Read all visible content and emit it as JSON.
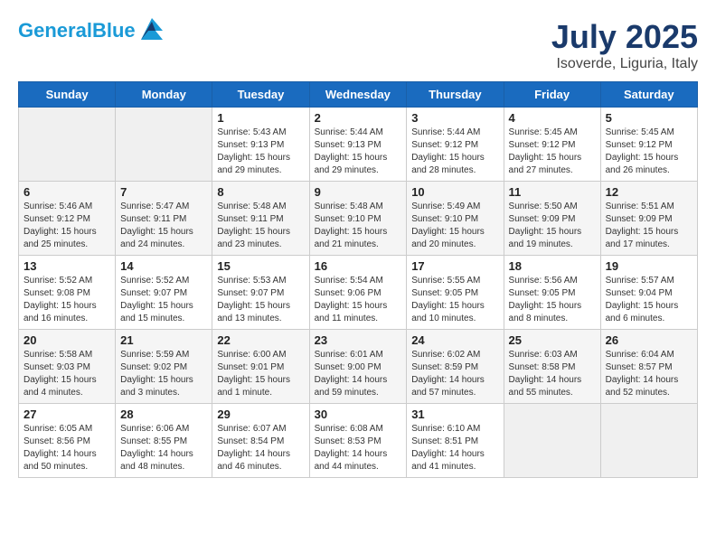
{
  "header": {
    "logo_line1": "General",
    "logo_line2": "Blue",
    "month": "July 2025",
    "location": "Isoverde, Liguria, Italy"
  },
  "days_of_week": [
    "Sunday",
    "Monday",
    "Tuesday",
    "Wednesday",
    "Thursday",
    "Friday",
    "Saturday"
  ],
  "weeks": [
    [
      {
        "day": "",
        "sunrise": "",
        "sunset": "",
        "daylight": ""
      },
      {
        "day": "",
        "sunrise": "",
        "sunset": "",
        "daylight": ""
      },
      {
        "day": "1",
        "sunrise": "Sunrise: 5:43 AM",
        "sunset": "Sunset: 9:13 PM",
        "daylight": "Daylight: 15 hours and 29 minutes."
      },
      {
        "day": "2",
        "sunrise": "Sunrise: 5:44 AM",
        "sunset": "Sunset: 9:13 PM",
        "daylight": "Daylight: 15 hours and 29 minutes."
      },
      {
        "day": "3",
        "sunrise": "Sunrise: 5:44 AM",
        "sunset": "Sunset: 9:12 PM",
        "daylight": "Daylight: 15 hours and 28 minutes."
      },
      {
        "day": "4",
        "sunrise": "Sunrise: 5:45 AM",
        "sunset": "Sunset: 9:12 PM",
        "daylight": "Daylight: 15 hours and 27 minutes."
      },
      {
        "day": "5",
        "sunrise": "Sunrise: 5:45 AM",
        "sunset": "Sunset: 9:12 PM",
        "daylight": "Daylight: 15 hours and 26 minutes."
      }
    ],
    [
      {
        "day": "6",
        "sunrise": "Sunrise: 5:46 AM",
        "sunset": "Sunset: 9:12 PM",
        "daylight": "Daylight: 15 hours and 25 minutes."
      },
      {
        "day": "7",
        "sunrise": "Sunrise: 5:47 AM",
        "sunset": "Sunset: 9:11 PM",
        "daylight": "Daylight: 15 hours and 24 minutes."
      },
      {
        "day": "8",
        "sunrise": "Sunrise: 5:48 AM",
        "sunset": "Sunset: 9:11 PM",
        "daylight": "Daylight: 15 hours and 23 minutes."
      },
      {
        "day": "9",
        "sunrise": "Sunrise: 5:48 AM",
        "sunset": "Sunset: 9:10 PM",
        "daylight": "Daylight: 15 hours and 21 minutes."
      },
      {
        "day": "10",
        "sunrise": "Sunrise: 5:49 AM",
        "sunset": "Sunset: 9:10 PM",
        "daylight": "Daylight: 15 hours and 20 minutes."
      },
      {
        "day": "11",
        "sunrise": "Sunrise: 5:50 AM",
        "sunset": "Sunset: 9:09 PM",
        "daylight": "Daylight: 15 hours and 19 minutes."
      },
      {
        "day": "12",
        "sunrise": "Sunrise: 5:51 AM",
        "sunset": "Sunset: 9:09 PM",
        "daylight": "Daylight: 15 hours and 17 minutes."
      }
    ],
    [
      {
        "day": "13",
        "sunrise": "Sunrise: 5:52 AM",
        "sunset": "Sunset: 9:08 PM",
        "daylight": "Daylight: 15 hours and 16 minutes."
      },
      {
        "day": "14",
        "sunrise": "Sunrise: 5:52 AM",
        "sunset": "Sunset: 9:07 PM",
        "daylight": "Daylight: 15 hours and 15 minutes."
      },
      {
        "day": "15",
        "sunrise": "Sunrise: 5:53 AM",
        "sunset": "Sunset: 9:07 PM",
        "daylight": "Daylight: 15 hours and 13 minutes."
      },
      {
        "day": "16",
        "sunrise": "Sunrise: 5:54 AM",
        "sunset": "Sunset: 9:06 PM",
        "daylight": "Daylight: 15 hours and 11 minutes."
      },
      {
        "day": "17",
        "sunrise": "Sunrise: 5:55 AM",
        "sunset": "Sunset: 9:05 PM",
        "daylight": "Daylight: 15 hours and 10 minutes."
      },
      {
        "day": "18",
        "sunrise": "Sunrise: 5:56 AM",
        "sunset": "Sunset: 9:05 PM",
        "daylight": "Daylight: 15 hours and 8 minutes."
      },
      {
        "day": "19",
        "sunrise": "Sunrise: 5:57 AM",
        "sunset": "Sunset: 9:04 PM",
        "daylight": "Daylight: 15 hours and 6 minutes."
      }
    ],
    [
      {
        "day": "20",
        "sunrise": "Sunrise: 5:58 AM",
        "sunset": "Sunset: 9:03 PM",
        "daylight": "Daylight: 15 hours and 4 minutes."
      },
      {
        "day": "21",
        "sunrise": "Sunrise: 5:59 AM",
        "sunset": "Sunset: 9:02 PM",
        "daylight": "Daylight: 15 hours and 3 minutes."
      },
      {
        "day": "22",
        "sunrise": "Sunrise: 6:00 AM",
        "sunset": "Sunset: 9:01 PM",
        "daylight": "Daylight: 15 hours and 1 minute."
      },
      {
        "day": "23",
        "sunrise": "Sunrise: 6:01 AM",
        "sunset": "Sunset: 9:00 PM",
        "daylight": "Daylight: 14 hours and 59 minutes."
      },
      {
        "day": "24",
        "sunrise": "Sunrise: 6:02 AM",
        "sunset": "Sunset: 8:59 PM",
        "daylight": "Daylight: 14 hours and 57 minutes."
      },
      {
        "day": "25",
        "sunrise": "Sunrise: 6:03 AM",
        "sunset": "Sunset: 8:58 PM",
        "daylight": "Daylight: 14 hours and 55 minutes."
      },
      {
        "day": "26",
        "sunrise": "Sunrise: 6:04 AM",
        "sunset": "Sunset: 8:57 PM",
        "daylight": "Daylight: 14 hours and 52 minutes."
      }
    ],
    [
      {
        "day": "27",
        "sunrise": "Sunrise: 6:05 AM",
        "sunset": "Sunset: 8:56 PM",
        "daylight": "Daylight: 14 hours and 50 minutes."
      },
      {
        "day": "28",
        "sunrise": "Sunrise: 6:06 AM",
        "sunset": "Sunset: 8:55 PM",
        "daylight": "Daylight: 14 hours and 48 minutes."
      },
      {
        "day": "29",
        "sunrise": "Sunrise: 6:07 AM",
        "sunset": "Sunset: 8:54 PM",
        "daylight": "Daylight: 14 hours and 46 minutes."
      },
      {
        "day": "30",
        "sunrise": "Sunrise: 6:08 AM",
        "sunset": "Sunset: 8:53 PM",
        "daylight": "Daylight: 14 hours and 44 minutes."
      },
      {
        "day": "31",
        "sunrise": "Sunrise: 6:10 AM",
        "sunset": "Sunset: 8:51 PM",
        "daylight": "Daylight: 14 hours and 41 minutes."
      },
      {
        "day": "",
        "sunrise": "",
        "sunset": "",
        "daylight": ""
      },
      {
        "day": "",
        "sunrise": "",
        "sunset": "",
        "daylight": ""
      }
    ]
  ]
}
